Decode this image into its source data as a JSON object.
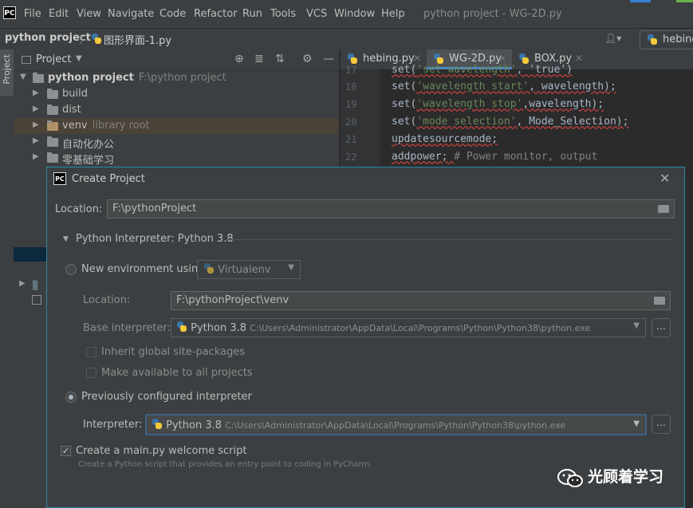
{
  "menubar": {
    "logo": "PC",
    "items": [
      "File",
      "Edit",
      "View",
      "Navigate",
      "Code",
      "Refactor",
      "Run",
      "Tools",
      "VCS",
      "Window",
      "Help"
    ],
    "title": "python project - WG-2D.py"
  },
  "navbar": {
    "project": "python project",
    "file": "图形界面-1.py",
    "run_config": "hebing"
  },
  "stripe": {
    "label": "Project"
  },
  "project_panel": {
    "title": "Project",
    "tree": [
      {
        "name": "python project",
        "path": "F:\\python project"
      },
      {
        "name": "build"
      },
      {
        "name": "dist"
      },
      {
        "name": "venv",
        "hint": "library root"
      },
      {
        "name": "自动化办公"
      },
      {
        "name": "零基础学习"
      }
    ]
  },
  "editor": {
    "tabs": [
      {
        "label": "hebing.py"
      },
      {
        "label": "WG-2D.py"
      },
      {
        "label": "BOX.py"
      }
    ],
    "lines": [
      {
        "no": "17",
        "pre": "set(",
        "str": "'set wavelength'",
        "post": ", 'true')"
      },
      {
        "no": "18",
        "pre": "set(",
        "str": "'wavelength start'",
        "post": ", wavelength);"
      },
      {
        "no": "19",
        "pre": "set(",
        "str": "'wavelength stop'",
        "post": ",wavelength);"
      },
      {
        "no": "20",
        "pre": "set(",
        "str": "'mode selection'",
        "post": ", Mode_Selection);"
      },
      {
        "no": "21",
        "pre": "updatesourcemode;",
        "str": "",
        "post": ""
      },
      {
        "no": "22",
        "pre": "addpower; ",
        "str": "",
        "post": "# Power monitor, output"
      }
    ]
  },
  "dialog": {
    "title": "Create Project",
    "location_label": "Location:",
    "location_value": "F:\\pythonProject",
    "interpreter_section": "Python Interpreter: Python 3.8",
    "new_env_label": "New environment using",
    "new_env_tool": "Virtualenv",
    "env_location_label": "Location:",
    "env_location_value": "F:\\pythonProject\\venv",
    "base_interp_label": "Base interpreter:",
    "base_interp_name": "Python 3.8",
    "base_interp_path": "C:\\Users\\Administrator\\AppData\\Local\\Programs\\Python\\Python38\\python.exe",
    "inherit_label": "Inherit global site-packages",
    "make_available_label": "Make available to all projects",
    "prev_configured_label": "Previously configured interpreter",
    "interpreter_label": "Interpreter:",
    "interpreter_name": "Python 3.8",
    "interpreter_path": "C:\\Users\\Administrator\\AppData\\Local\\Programs\\Python\\Python38\\python.exe",
    "browse_label": "...",
    "create_main_label": "Create a main.py welcome script",
    "create_main_hint": "Create a Python script that provides an entry point to coding in PyCharm."
  },
  "watermark": "光顾着学习"
}
